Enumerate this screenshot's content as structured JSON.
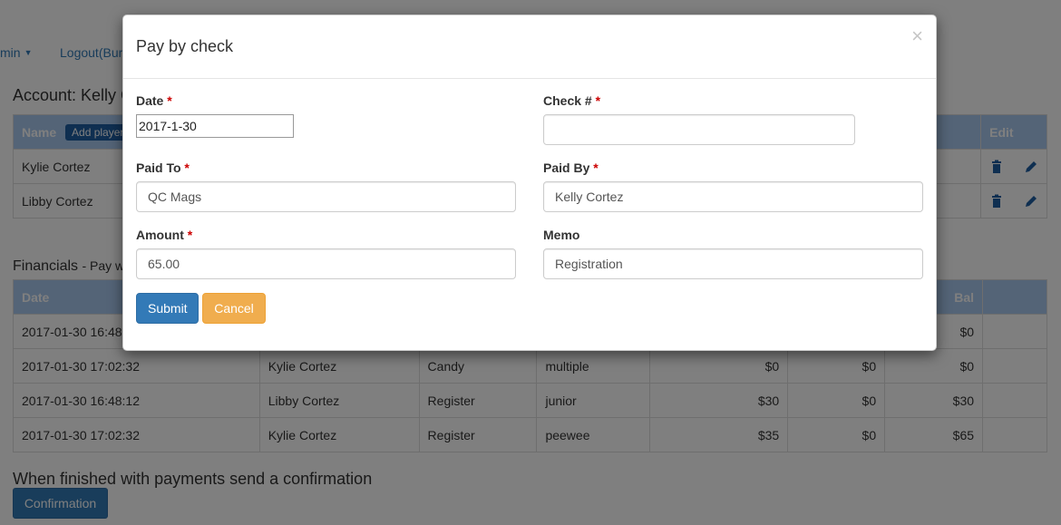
{
  "nav": {
    "admin_label": "min",
    "logout_label": "Logout(Bur"
  },
  "account": {
    "title": "Account: Kelly C"
  },
  "players": {
    "headers": {
      "name": "Name",
      "add_player": "Add player",
      "edit": "Edit"
    },
    "rows": [
      {
        "name": "Kylie Cortez"
      },
      {
        "name": "Libby Cortez"
      }
    ]
  },
  "financials": {
    "title": "Financials",
    "subtitle": "- Pay w",
    "headers": {
      "date": "Date",
      "bal": "Bal"
    },
    "rows": [
      {
        "date": "2017-01-30 16:48",
        "player": "",
        "item": "",
        "desc": "",
        "amt1": "",
        "amt2": "",
        "bal": "$0"
      },
      {
        "date": "2017-01-30 17:02:32",
        "player": "Kylie Cortez",
        "item": "Candy",
        "desc": "multiple",
        "amt1": "$0",
        "amt2": "$0",
        "bal": "$0"
      },
      {
        "date": "2017-01-30 16:48:12",
        "player": "Libby Cortez",
        "item": "Register",
        "desc": "junior",
        "amt1": "$30",
        "amt2": "$0",
        "bal": "$30"
      },
      {
        "date": "2017-01-30 17:02:32",
        "player": "Kylie Cortez",
        "item": "Register",
        "desc": "peewee",
        "amt1": "$35",
        "amt2": "$0",
        "bal": "$65"
      }
    ]
  },
  "confirmation": {
    "text": "When finished with payments send a confirmation",
    "button": "Confirmation"
  },
  "modal": {
    "title": "Pay by check",
    "close": "×",
    "date": {
      "label": "Date",
      "value": "2017-1-30"
    },
    "check": {
      "label": "Check #",
      "value": ""
    },
    "paid_to": {
      "label": "Paid To",
      "value": "QC Mags"
    },
    "paid_by": {
      "label": "Paid By",
      "value": "Kelly Cortez"
    },
    "amount": {
      "label": "Amount",
      "value": "65.00"
    },
    "memo": {
      "label": "Memo",
      "value": "Registration"
    },
    "required_mark": "*",
    "submit": "Submit",
    "cancel": "Cancel"
  }
}
